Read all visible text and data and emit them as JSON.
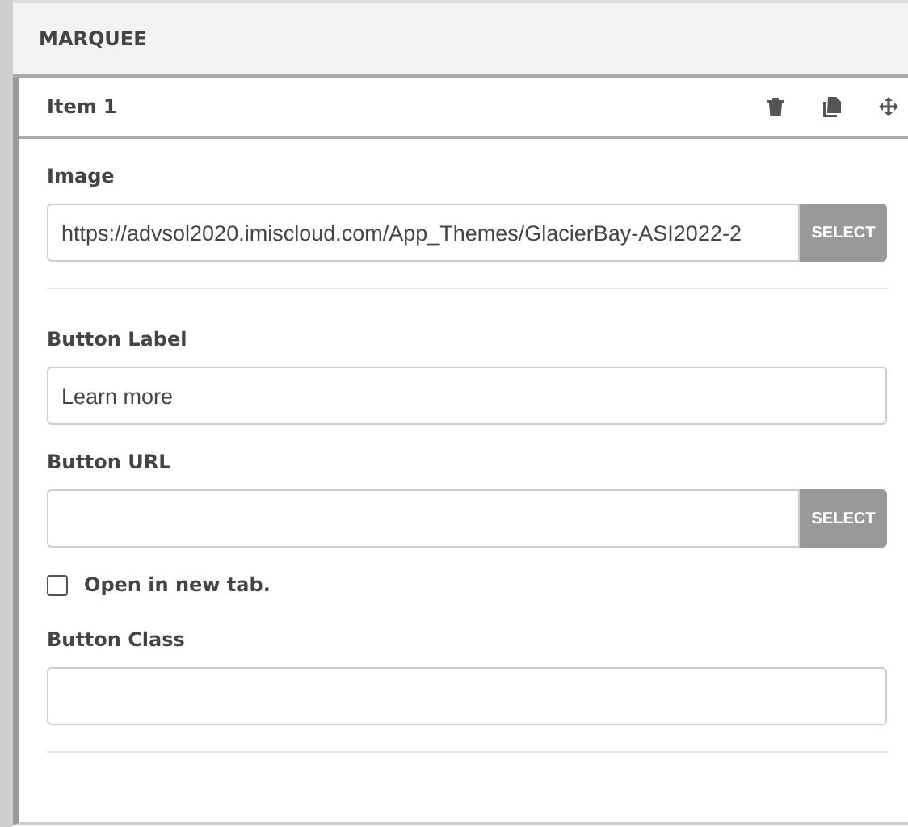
{
  "panel": {
    "title": "MARQUEE"
  },
  "item": {
    "title": "Item 1",
    "actions": [
      {
        "kind": "delete"
      },
      {
        "kind": "copy"
      },
      {
        "kind": "move"
      }
    ]
  },
  "fields": [
    {
      "kind": "select_input",
      "label": "Image",
      "value": "https://advsol2020.imiscloud.com/App_Themes/GlacierBay-ASI2022-2",
      "button": "SELECT"
    },
    {
      "kind": "divider"
    },
    {
      "kind": "text_input",
      "label": "Button Label",
      "value": "Learn more"
    },
    {
      "kind": "select_input",
      "label": "Button URL",
      "button": "SELECT"
    },
    {
      "kind": "checkbox",
      "label": "Open in new tab.",
      "checked": false
    },
    {
      "kind": "text_input",
      "label": "Button Class"
    },
    {
      "kind": "divider"
    }
  ]
}
